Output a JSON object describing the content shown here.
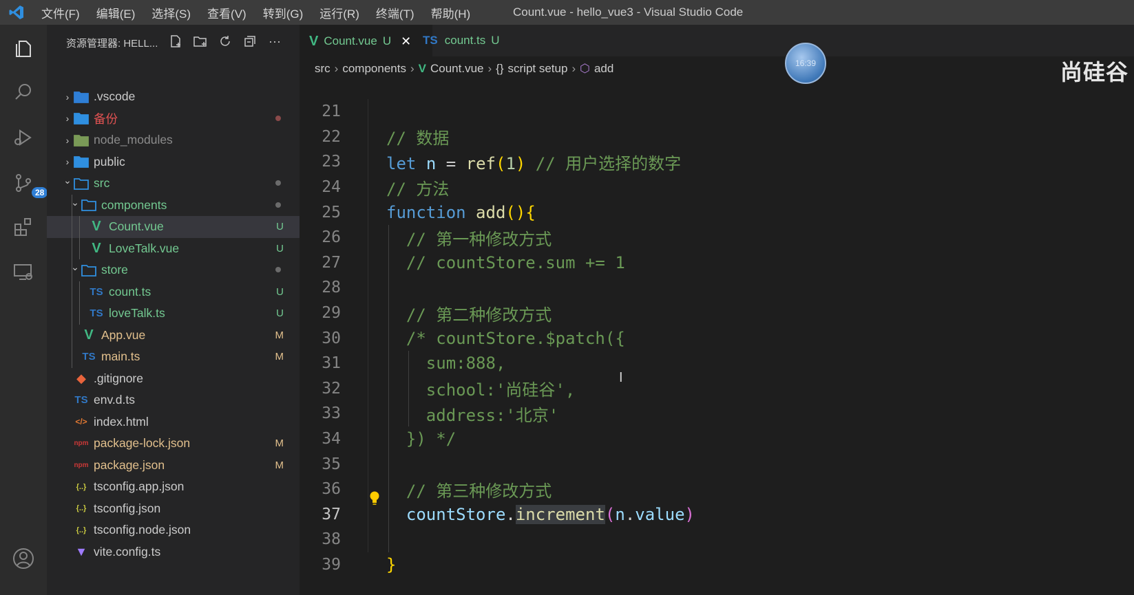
{
  "window": {
    "menu": [
      "文件(F)",
      "编辑(E)",
      "选择(S)",
      "查看(V)",
      "转到(G)",
      "运行(R)",
      "终端(T)",
      "帮助(H)"
    ],
    "title": "Count.vue - hello_vue3 - Visual Studio Code"
  },
  "activity_bar": {
    "source_control_badge": "28"
  },
  "explorer": {
    "header": "资源管理器: HELL...",
    "items": [
      {
        "label": ".vscode",
        "type": "folder",
        "expanded": false,
        "depth": 0,
        "status": ""
      },
      {
        "label": "备份",
        "type": "folder",
        "expanded": false,
        "depth": 0,
        "status": "dot"
      },
      {
        "label": "node_modules",
        "type": "folder",
        "expanded": false,
        "depth": 0,
        "status": ""
      },
      {
        "label": "public",
        "type": "folder",
        "expanded": false,
        "depth": 0,
        "status": ""
      },
      {
        "label": "src",
        "type": "folder",
        "expanded": true,
        "depth": 0,
        "status": "dot"
      },
      {
        "label": "components",
        "type": "folder",
        "expanded": true,
        "depth": 1,
        "status": "dot"
      },
      {
        "label": "Count.vue",
        "type": "vue",
        "depth": 2,
        "status": "U"
      },
      {
        "label": "LoveTalk.vue",
        "type": "vue",
        "depth": 2,
        "status": "U"
      },
      {
        "label": "store",
        "type": "folder",
        "expanded": true,
        "depth": 1,
        "status": "dot"
      },
      {
        "label": "count.ts",
        "type": "ts",
        "depth": 2,
        "status": "U"
      },
      {
        "label": "loveTalk.ts",
        "type": "ts",
        "depth": 2,
        "status": "U"
      },
      {
        "label": "App.vue",
        "type": "vue",
        "depth": 1,
        "status": "M"
      },
      {
        "label": "main.ts",
        "type": "ts",
        "depth": 1,
        "status": "M"
      },
      {
        "label": ".gitignore",
        "type": "git",
        "depth": 0,
        "status": ""
      },
      {
        "label": "env.d.ts",
        "type": "ts",
        "depth": 0,
        "status": ""
      },
      {
        "label": "index.html",
        "type": "html",
        "depth": 0,
        "status": ""
      },
      {
        "label": "package-lock.json",
        "type": "npm",
        "depth": 0,
        "status": "M"
      },
      {
        "label": "package.json",
        "type": "npm",
        "depth": 0,
        "status": "M"
      },
      {
        "label": "tsconfig.app.json",
        "type": "json",
        "depth": 0,
        "status": ""
      },
      {
        "label": "tsconfig.json",
        "type": "json",
        "depth": 0,
        "status": ""
      },
      {
        "label": "tsconfig.node.json",
        "type": "json",
        "depth": 0,
        "status": ""
      },
      {
        "label": "vite.config.ts",
        "type": "vite",
        "depth": 0,
        "status": ""
      }
    ]
  },
  "tabs": [
    {
      "label": "Count.vue",
      "status": "U",
      "active": true,
      "icon": "V"
    },
    {
      "label": "count.ts",
      "status": "U",
      "active": false,
      "icon": "TS"
    }
  ],
  "breadcrumb": {
    "parts": [
      "src",
      "components",
      "Count.vue",
      "script setup",
      "add"
    ]
  },
  "overlay": {
    "watermark": "尚硅谷",
    "clock": "16:39"
  },
  "code": {
    "current_line": 37,
    "lines": [
      {
        "num": "21",
        "text": ""
      },
      {
        "num": "22",
        "text": "// 数据"
      },
      {
        "num": "23",
        "text": "let n = ref(1) // 用户选择的数字"
      },
      {
        "num": "24",
        "text": "// 方法"
      },
      {
        "num": "25",
        "text": "function add(){"
      },
      {
        "num": "26",
        "text": "  // 第一种修改方式"
      },
      {
        "num": "27",
        "text": "  // countStore.sum += 1"
      },
      {
        "num": "28",
        "text": ""
      },
      {
        "num": "29",
        "text": "  // 第二种修改方式"
      },
      {
        "num": "30",
        "text": "  /* countStore.$patch({"
      },
      {
        "num": "31",
        "text": "    sum:888,"
      },
      {
        "num": "32",
        "text": "    school:'尚硅谷',"
      },
      {
        "num": "33",
        "text": "    address:'北京'"
      },
      {
        "num": "34",
        "text": "  }) */"
      },
      {
        "num": "35",
        "text": ""
      },
      {
        "num": "36",
        "text": "  // 第三种修改方式"
      },
      {
        "num": "37",
        "text": "  countStore.increment(n.value)"
      },
      {
        "num": "38",
        "text": ""
      },
      {
        "num": "39",
        "text": "}"
      }
    ]
  },
  "colors": {
    "accent": "#007acc",
    "vue_green": "#41b883",
    "ts_blue": "#3178c6",
    "untracked": "#73c991",
    "modified": "#e2c08d"
  }
}
